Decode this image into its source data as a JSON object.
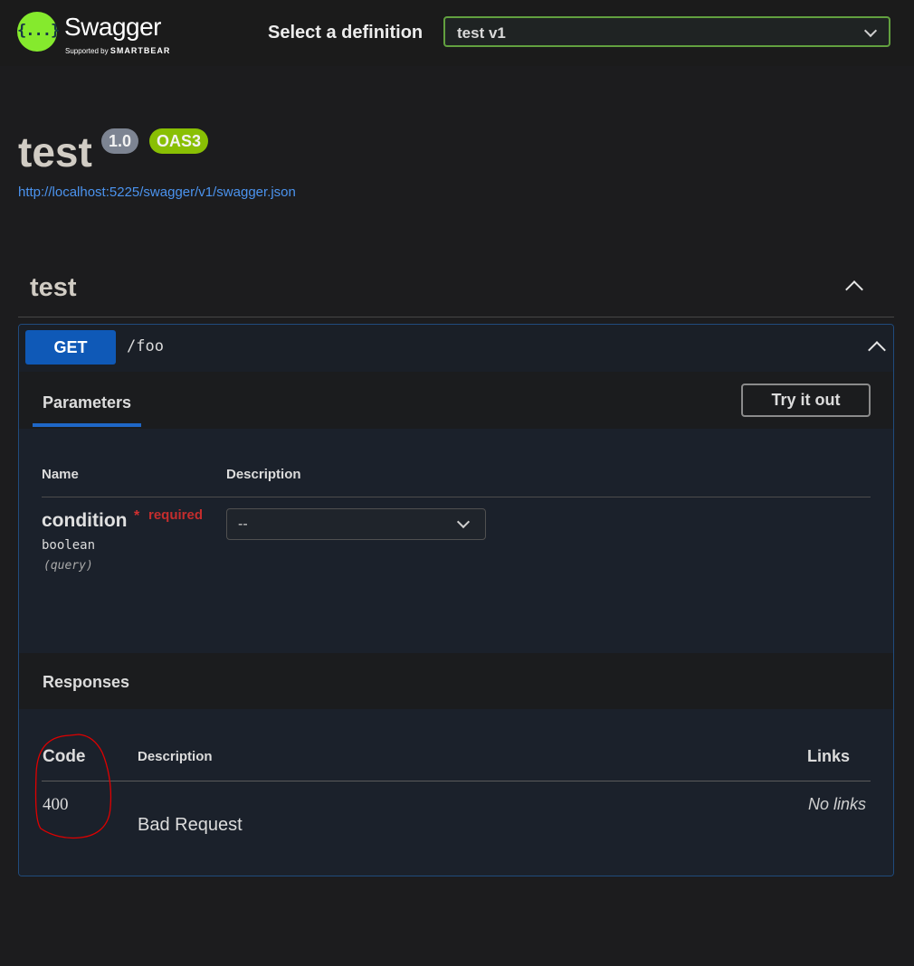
{
  "header": {
    "logo_mark": "{...}",
    "brand": "Swagger",
    "supported_by": "Supported by",
    "supporter": "SMARTBEAR",
    "select_label": "Select a definition",
    "selected_definition": "test v1"
  },
  "info": {
    "title": "test",
    "version": "1.0",
    "oas_badge": "OAS3",
    "spec_url": "http://localhost:5225/swagger/v1/swagger.json"
  },
  "tag": {
    "name": "test"
  },
  "operation": {
    "method": "GET",
    "path": "/foo",
    "parameters_tab": "Parameters",
    "try_it_out": "Try it out",
    "param_table_headers": {
      "name": "Name",
      "description": "Description"
    },
    "parameters": [
      {
        "name": "condition",
        "required_marker": "*",
        "required_text": "required",
        "type": "boolean",
        "in": "(query)",
        "selected_value": "--"
      }
    ],
    "responses_title": "Responses",
    "response_table_headers": {
      "code": "Code",
      "description": "Description",
      "links": "Links"
    },
    "responses": [
      {
        "code": "400",
        "description": "Bad Request",
        "links": "No links"
      }
    ]
  },
  "colors": {
    "get_method": "#0f59b7",
    "logo_green": "#85ea2d",
    "oas_badge": "#89bf04",
    "version_badge": "#7d8492",
    "required_red": "#c42d2d",
    "annotation_red": "#e00000"
  }
}
